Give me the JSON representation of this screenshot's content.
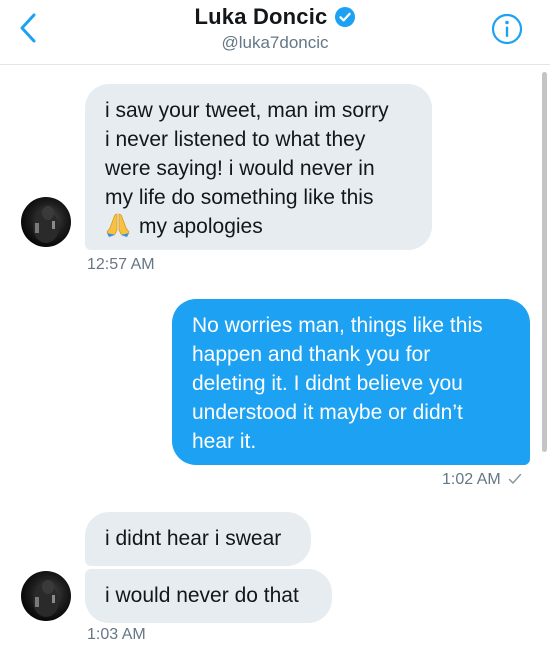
{
  "header": {
    "name": "Luka Doncic",
    "handle": "@luka7doncic",
    "back_icon": "chevron-left-icon",
    "verified_icon": "verified-badge-icon",
    "info_icon": "info-icon",
    "accent_color": "#1da1f2"
  },
  "messages": [
    {
      "direction": "received",
      "lines": [
        "i saw your tweet, man im sorry",
        "i never listened to what they",
        "were saying! i would never in",
        "my life do something like this",
        "my apologies"
      ],
      "emoji": "🙏",
      "time": "12:57 AM"
    },
    {
      "direction": "sent",
      "lines": [
        "No worries man, things like this",
        "happen and thank you for",
        "deleting it. I didnt believe you",
        "understood it maybe or didn’t",
        "hear it."
      ],
      "time": "1:02 AM",
      "status_icon": "checkmark-icon"
    },
    {
      "direction": "received",
      "lines": [
        "i didnt hear i swear"
      ]
    },
    {
      "direction": "received",
      "lines": [
        "i would never do that"
      ],
      "time": "1:03 AM"
    }
  ]
}
